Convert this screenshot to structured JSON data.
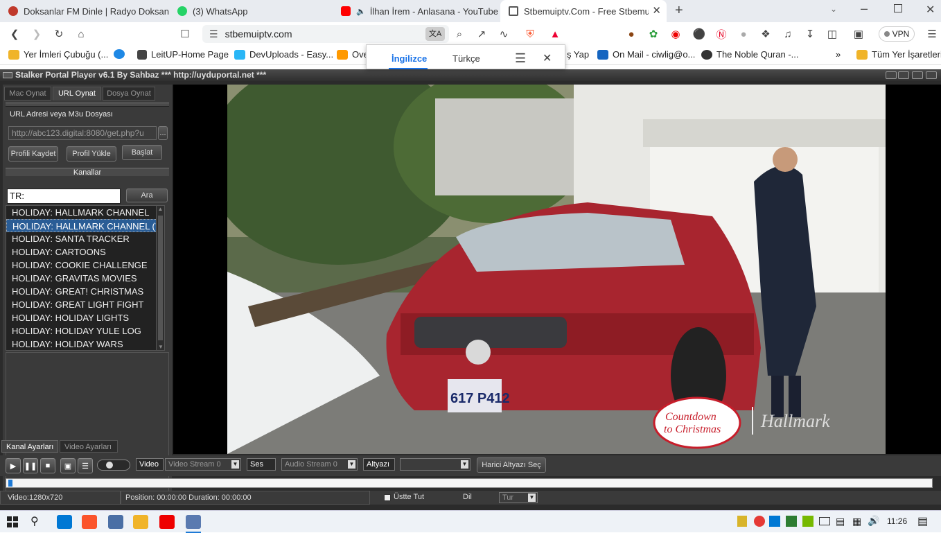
{
  "browser": {
    "tabs": [
      {
        "title": "Doksanlar FM Dinle | Radyo Doksanlar",
        "favicon_color": "#c0392b"
      },
      {
        "title": "(3) WhatsApp",
        "favicon_color": "#25d366"
      },
      {
        "title": "İlhan İrem - Anlasana - YouTube",
        "favicon_color": "#ff0000"
      },
      {
        "title": "Stbemuiptv.Com - Free Stbemu C",
        "favicon_color": "#555555"
      }
    ],
    "url": "stbemuiptv.com",
    "vpn_label": "VPN",
    "bookmarks": [
      "Yer İmleri Çubuğu (...",
      "LeitUP-Home Page",
      "DevUploads - Easy...",
      "Ove",
      "ş Yap",
      "On Mail - ciwlig@o...",
      "The Noble Quran -...",
      "Tüm Yer İşaretleri"
    ],
    "translate": {
      "lang_from": "İngilizce",
      "lang_to": "Türkçe"
    }
  },
  "app": {
    "title": "Stalker Portal Player v6.1 By Sahbaz  *** http://uyduportal.net ***",
    "left_tabs": [
      "Mac Oynat",
      "URL Oynat",
      "Dosya Oynat"
    ],
    "url_section_label": "URL Adresi veya M3u Dosyası",
    "url_value": "http://abc123.digital:8080/get.php?u",
    "browse_btn": "...",
    "buttons": {
      "save_profile": "Profili Kaydet",
      "load_profile": "Profil Yükle",
      "start": "Başlat"
    },
    "channels_label": "Kanallar",
    "search_value": "TR:",
    "search_btn": "Ara",
    "channels": [
      "HOLIDAY: HALLMARK CHANNEL",
      "HOLIDAY: HALLMARK CHANNEL (’",
      "HOLIDAY: SANTA TRACKER",
      "HOLIDAY: CARTOONS",
      "HOLIDAY: COOKIE CHALLENGE",
      "HOLIDAY: GRAVITAS MOVIES",
      "HOLIDAY: GREAT! CHRISTMAS",
      "HOLIDAY: GREAT LIGHT FIGHT",
      "HOLIDAY: HOLIDAY LIGHTS",
      "HOLIDAY: HOLIDAY YULE LOG",
      "HOLIDAY: HOLIDAY WARS"
    ],
    "selected_channel_index": 1,
    "bottom_tabs": [
      "Kanal Ayarları",
      "Video Ayarları"
    ],
    "controls": {
      "video_label": "Video",
      "video_stream": "Video Stream 0",
      "audio_label": "Ses",
      "audio_stream": "Audio Stream 0",
      "subtitle_label": "Altyazı",
      "subtitle_value": "",
      "external_sub_btn": "Harici Altyazı Seç"
    },
    "status": {
      "video_info": "Video:1280x720",
      "position": "Position: 00:00:00 Duration: 00:00:00",
      "on_top_label": "Üstte Tut",
      "lang_label": "Dil",
      "lang_value": "Tur"
    },
    "video_overlay": {
      "show_logo_line1": "Countdown",
      "show_logo_line2": "to Christmas",
      "network_logo": "Hallmark",
      "plate": "617 P412"
    }
  },
  "taskbar": {
    "time": "11:26"
  }
}
